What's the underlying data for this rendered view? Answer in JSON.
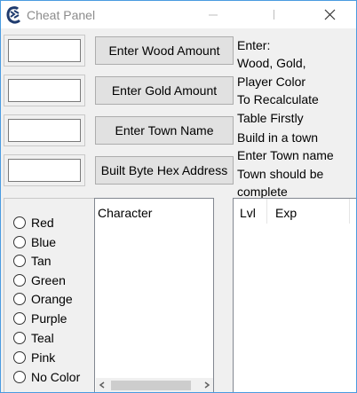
{
  "window": {
    "title": "Cheat Panel",
    "icon": "cheat-engine-icon",
    "controls": {
      "minimize": "minimize-icon",
      "maximize": "maximize-icon",
      "close": "close-icon"
    }
  },
  "inputs": [
    {
      "name": "wood-amount-input",
      "value": ""
    },
    {
      "name": "gold-amount-input",
      "value": ""
    },
    {
      "name": "town-name-input",
      "value": ""
    },
    {
      "name": "byte-hex-input",
      "value": ""
    }
  ],
  "buttons": {
    "wood": "Enter Wood Amount",
    "gold": "Enter Gold Amount",
    "town": "Enter Town Name",
    "hex": "Built Byte Hex Address"
  },
  "instructions": [
    "Enter:",
    "Wood, Gold,",
    "Player Color",
    "To Recalculate",
    "Table Firstly",
    "Build in a town",
    "Enter Town name",
    "Town should be",
    "complete"
  ],
  "colors": [
    "Red",
    "Blue",
    "Tan",
    "Green",
    "Orange",
    "Purple",
    "Teal",
    "Pink",
    "No Color"
  ],
  "character_list": {
    "header": "Character"
  },
  "level_list": {
    "columns": [
      "Lvl",
      "Exp"
    ]
  },
  "theme": {
    "title_bar": "#ffffff",
    "window_bg": "#f0f0f0",
    "button_bg": "#e1e1e1",
    "border_accent": "#4a9be0"
  }
}
